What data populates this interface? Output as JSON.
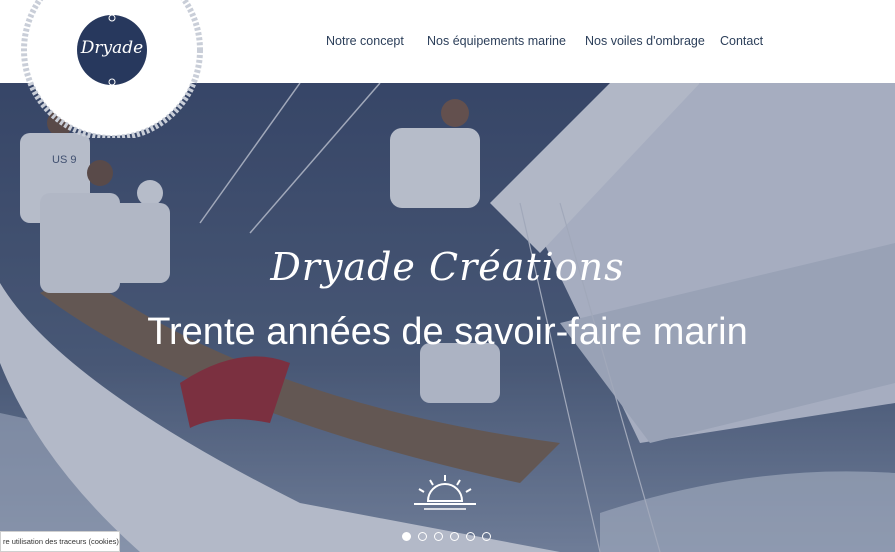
{
  "logo": {
    "text": "Dryade"
  },
  "nav": {
    "items": [
      {
        "label": "Notre concept"
      },
      {
        "label": "Nos équipements marine"
      },
      {
        "label": "Nos voiles d'ombrage"
      },
      {
        "label": "Contact"
      }
    ]
  },
  "hero": {
    "script_title": "Dryade Créations",
    "main_title": "Trente années de savoir-faire marin",
    "sail_number": "US 9",
    "slides": {
      "count": 6,
      "active": 1
    }
  },
  "cookie": {
    "text": "re utilisation des traceurs (cookies)"
  },
  "colors": {
    "navy": "#2c3f5a",
    "overlay": "#3c4d75",
    "white": "#ffffff"
  }
}
